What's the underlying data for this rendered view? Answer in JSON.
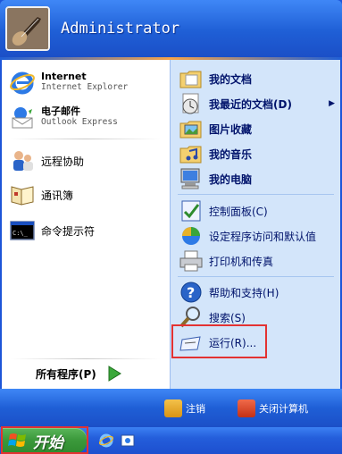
{
  "header": {
    "username": "Administrator"
  },
  "left": {
    "pinned": [
      {
        "title": "Internet",
        "subtitle": "Internet Explorer",
        "icon": "ie-icon"
      },
      {
        "title": "电子邮件",
        "subtitle": "Outlook Express",
        "icon": "outlook-express-icon"
      }
    ],
    "recent": [
      {
        "label": "远程协助",
        "icon": "remote-assistance-icon"
      },
      {
        "label": "通讯簿",
        "icon": "address-book-icon"
      },
      {
        "label": "命令提示符",
        "icon": "command-prompt-icon"
      }
    ],
    "all_programs": "所有程序(P)"
  },
  "right": {
    "group1": [
      {
        "label": "我的文档",
        "icon": "my-documents-icon"
      },
      {
        "label": "我最近的文档(D)",
        "icon": "recent-documents-icon",
        "has_submenu": true
      },
      {
        "label": "图片收藏",
        "icon": "my-pictures-icon"
      },
      {
        "label": "我的音乐",
        "icon": "my-music-icon"
      },
      {
        "label": "我的电脑",
        "icon": "my-computer-icon"
      }
    ],
    "group2": [
      {
        "label": "控制面板(C)",
        "icon": "control-panel-icon"
      },
      {
        "label": "设定程序访问和默认值",
        "icon": "program-defaults-icon"
      },
      {
        "label": "打印机和传真",
        "icon": "printer-icon"
      }
    ],
    "group3": [
      {
        "label": "帮助和支持(H)",
        "icon": "help-icon"
      },
      {
        "label": "搜索(S)",
        "icon": "search-icon"
      },
      {
        "label": "运行(R)...",
        "icon": "run-icon"
      }
    ]
  },
  "footer": {
    "logoff": "注销",
    "shutdown": "关闭计算机"
  },
  "taskbar": {
    "start_label": "开始"
  },
  "colors": {
    "highlight_box": "#e33232",
    "right_pane": "#d3e5fa",
    "header_blue": "#1f5fd6"
  }
}
